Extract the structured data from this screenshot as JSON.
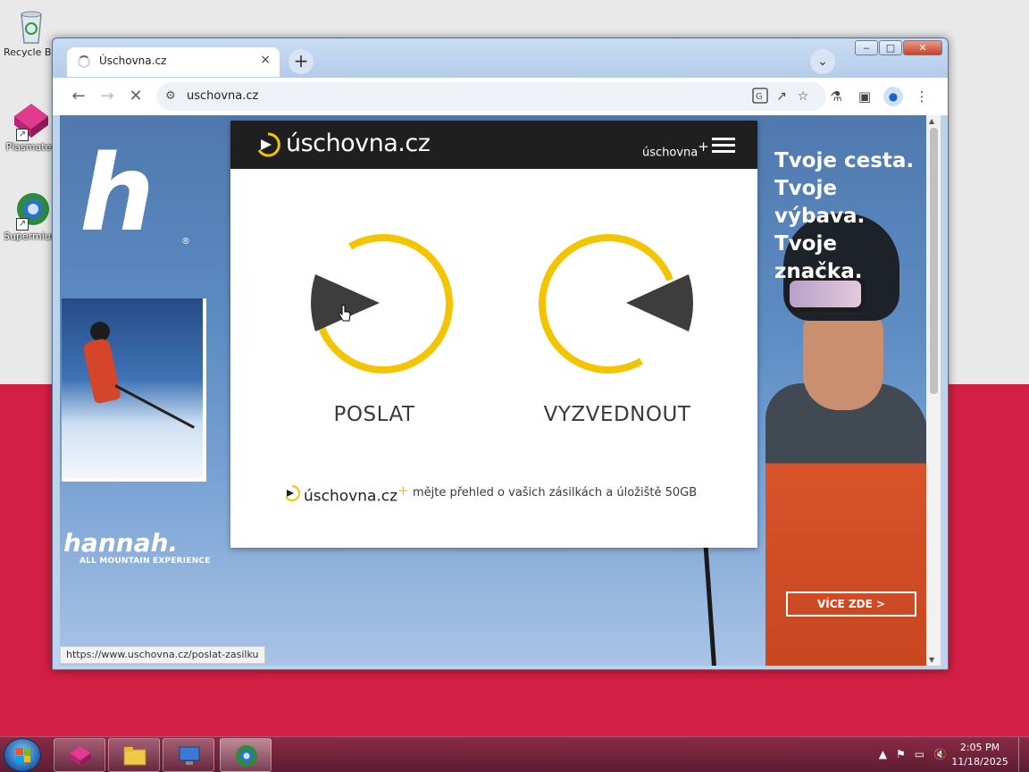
{
  "desktop": {
    "icons": [
      {
        "label": "Recycle Bin",
        "icon": "recycle-bin-icon"
      },
      {
        "label": "Plasmatec",
        "icon": "plasma-icon"
      },
      {
        "label": "Supermium",
        "icon": "browser-globe-icon"
      }
    ]
  },
  "browser": {
    "window_controls": {
      "minimize": "‒",
      "maximize": "□",
      "close": "✕"
    },
    "tab": {
      "title": "Úschovna.cz",
      "close": "×"
    },
    "new_tab": "+",
    "tabs_menu": "⌄",
    "nav": {
      "back": "←",
      "forward": "→",
      "stop": "✕"
    },
    "address": {
      "url": "uschovna.cz"
    },
    "toolbar_icons": [
      "translate-icon",
      "share-icon",
      "bookmark-star-icon",
      "labs-icon",
      "side-panel-icon",
      "profile-icon",
      "menu-dots-icon"
    ],
    "status_url": "https://www.uschovna.cz/poslat-zasilku"
  },
  "site": {
    "brand": "úschovna.cz",
    "plus_link": "úschovna",
    "plus_sign": "+",
    "actions": [
      {
        "label": "POSLAT",
        "icon": "send-arrow-icon"
      },
      {
        "label": "VYZVEDNOUT",
        "icon": "pickup-arrow-icon"
      }
    ],
    "promo": {
      "brand": "úschovna.cz",
      "plus_sign": "+",
      "text": "mějte přehled o vašich zásilkách a úložiště 50GB"
    },
    "colors": {
      "accent": "#f2c500",
      "header": "#1f1f1f",
      "arrow": "#3d3d3d"
    }
  },
  "ad": {
    "left": {
      "logo": "h",
      "reg": "®",
      "brand": "hannah.",
      "tagline": "ALL MOUNTAIN EXPERIENCE"
    },
    "right": {
      "slogan": [
        "Tvoje cesta.",
        "Tvoje výbava.",
        "Tvoje značka."
      ],
      "cta": "VÍCE ZDE  >"
    }
  },
  "taskbar": {
    "apps": [
      "plasma-app",
      "file-explorer",
      "remote-desktop",
      "supermium-browser"
    ],
    "clock": {
      "time": "2:05 PM",
      "date": "11/18/2025"
    },
    "tray": [
      "▲",
      "⚑",
      "▭",
      "🔇"
    ]
  }
}
